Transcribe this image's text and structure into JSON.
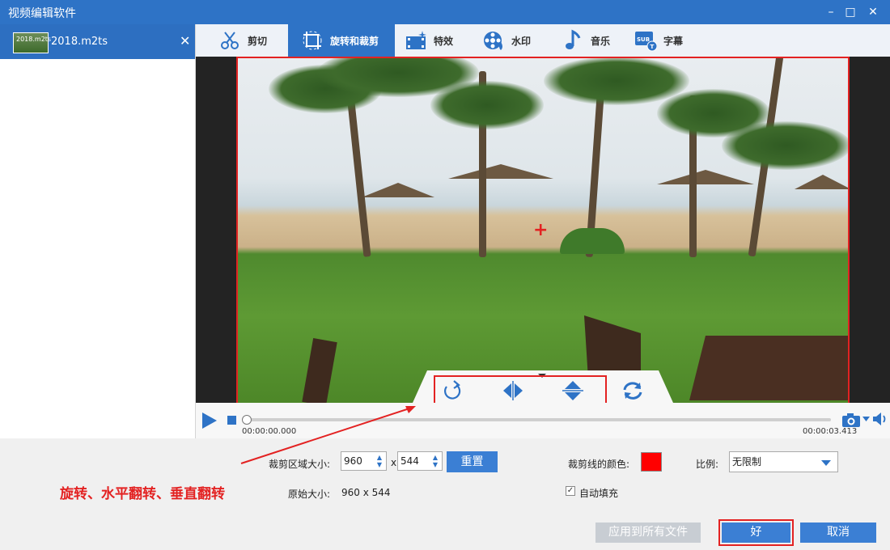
{
  "window": {
    "title": "视频编辑软件"
  },
  "sidebar": {
    "file_name": "2018.m2ts",
    "thumb_text": "2018.m2ts"
  },
  "tabs": [
    {
      "label": "剪切",
      "icon": "scissors-icon"
    },
    {
      "label": "旋转和裁剪",
      "icon": "crop-rotate-icon",
      "active": true
    },
    {
      "label": "特效",
      "icon": "effects-icon"
    },
    {
      "label": "水印",
      "icon": "watermark-icon"
    },
    {
      "label": "音乐",
      "icon": "music-note-icon"
    },
    {
      "label": "字幕",
      "icon": "subtitle-icon"
    }
  ],
  "player": {
    "current_time": "00:00:00.000",
    "total_time": "00:00:03.413",
    "progress": 0
  },
  "crop": {
    "area_label": "裁剪区域大小:",
    "width": "960",
    "height": "544",
    "separator": "x",
    "reset_label": "重置",
    "original_label": "原始大小:",
    "original_value": "960 x 544",
    "line_color_label": "裁剪线的颜色:",
    "line_color": "#ff0000",
    "ratio_label": "比例:",
    "ratio_value": "无限制",
    "autofill_label": "自动填充",
    "autofill_checked": true
  },
  "annotation": {
    "text": "旋转、水平翻转、垂直翻转"
  },
  "buttons": {
    "apply_all": "应用到所有文件",
    "ok": "好",
    "cancel": "取消"
  },
  "colors": {
    "accent": "#2e73c6",
    "highlight": "#e32222"
  }
}
